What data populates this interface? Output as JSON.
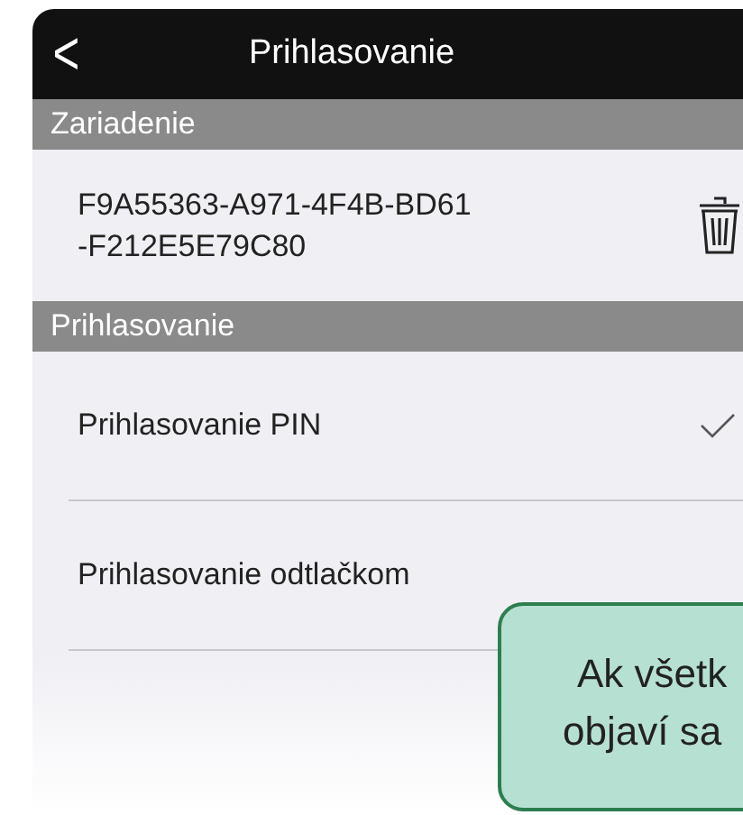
{
  "nav_bar": {
    "back": "<",
    "title": "Prihlasovanie"
  },
  "sections": [
    {
      "header": "Zariadenie",
      "device": {
        "id_lines": [
          "F9A55363-A971-4F4B-BD61",
          "-F212E5E79C80"
        ]
      }
    },
    {
      "header": "Prihlasovanie",
      "options": [
        {
          "label": "Prihlasovanie PIN",
          "checked": true
        },
        {
          "label": "Prihlasovanie odtlačkom",
          "checked": false
        }
      ]
    }
  ],
  "callout": {
    "lines": [
      "Ak všetk",
      "objaví sa"
    ]
  }
}
